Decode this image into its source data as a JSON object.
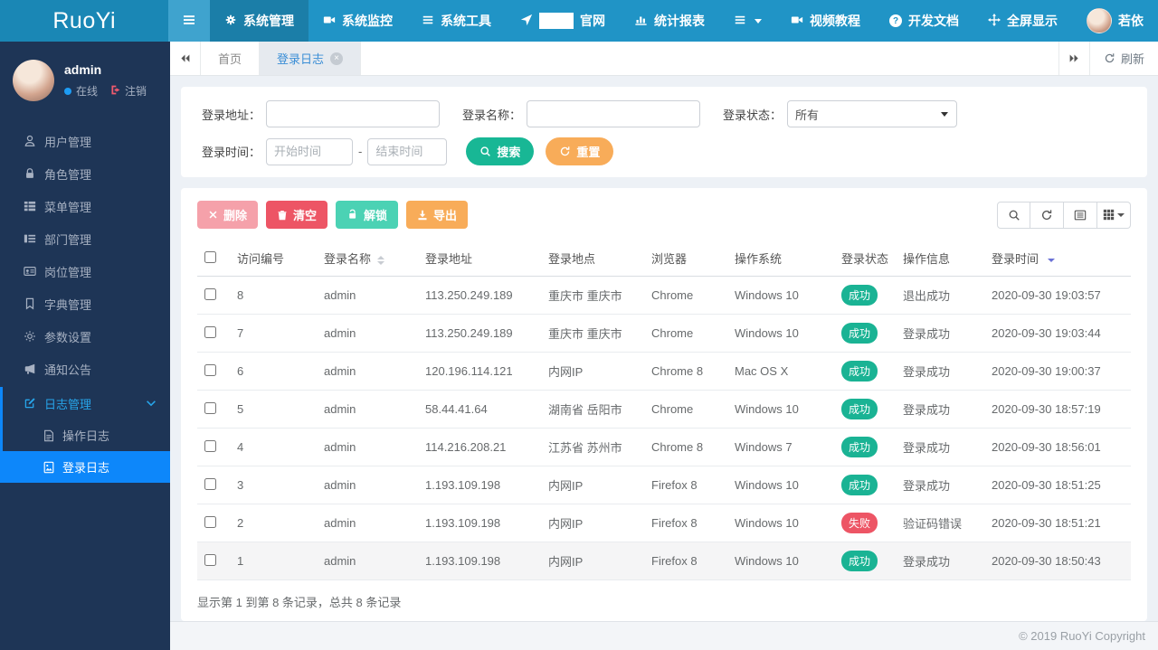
{
  "colors": {
    "navbar": "#2094c6",
    "sidebar": "#1e3556",
    "active_blue": "#0d87fa",
    "success": "#1ab394",
    "danger": "#ed5565",
    "warning": "#f8ac59"
  },
  "icons": {
    "hamburger": "bars",
    "tab_back": "«",
    "tab_forward": "»",
    "caret_down": "▾"
  },
  "navbar": {
    "brand": "RuoYi",
    "menu": [
      {
        "label": "系统管理",
        "icon": "gear-icon",
        "active": true
      },
      {
        "label": "系统监控",
        "icon": "video-camera-icon",
        "active": false
      },
      {
        "label": "系统工具",
        "icon": "bars-icon",
        "active": false
      },
      {
        "label": "官网",
        "icon": "location-arrow-icon",
        "active": false
      },
      {
        "label": "统计报表",
        "icon": "bar-chart-icon",
        "active": false
      }
    ],
    "right": [
      {
        "label": "视频教程",
        "icon": "video-camera-icon"
      },
      {
        "label": "开发文档",
        "icon": "question-circle-icon"
      },
      {
        "label": "全屏显示",
        "icon": "expand-icon"
      },
      {
        "label": "若依",
        "icon": "user-avatar"
      }
    ]
  },
  "sidebar": {
    "user": {
      "name": "admin",
      "online": "在线",
      "logout": "注销"
    },
    "items": [
      {
        "label": "用户管理",
        "icon": "user-icon"
      },
      {
        "label": "角色管理",
        "icon": "lock-icon"
      },
      {
        "label": "菜单管理",
        "icon": "menu-list-icon"
      },
      {
        "label": "部门管理",
        "icon": "department-icon"
      },
      {
        "label": "岗位管理",
        "icon": "id-card-icon"
      },
      {
        "label": "字典管理",
        "icon": "bookmark-icon"
      },
      {
        "label": "参数设置",
        "icon": "settings-icon"
      },
      {
        "label": "通知公告",
        "icon": "megaphone-icon"
      }
    ],
    "log_group": {
      "label": "日志管理",
      "children": [
        {
          "label": "操作日志",
          "active": false
        },
        {
          "label": "登录日志",
          "active": true
        }
      ]
    }
  },
  "tabbar": {
    "tabs": [
      {
        "label": "首页",
        "active": false
      },
      {
        "label": "登录日志",
        "active": true,
        "closable": true
      }
    ],
    "refresh_label": "刷新"
  },
  "search": {
    "address_label": "登录地址：",
    "name_label": "登录名称：",
    "status_label": "登录状态：",
    "status_value": "所有",
    "time_label": "登录时间：",
    "start_placeholder": "开始时间",
    "end_placeholder": "结束时间",
    "range_separator": "-",
    "search_button": "搜索",
    "reset_button": "重置"
  },
  "toolbar": {
    "delete_button": "删除",
    "clear_button": "清空",
    "unlock_button": "解锁",
    "export_button": "导出"
  },
  "table": {
    "headers": [
      "访问编号",
      "登录名称",
      "登录地址",
      "登录地点",
      "浏览器",
      "操作系统",
      "登录状态",
      "操作信息",
      "登录时间"
    ],
    "rows": [
      {
        "id": "8",
        "name": "admin",
        "ip": "113.250.249.189",
        "location": "重庆市 重庆市",
        "browser": "Chrome",
        "os": "Windows 10",
        "status": "成功",
        "status_type": "success",
        "message": "退出成功",
        "time": "2020-09-30 19:03:57"
      },
      {
        "id": "7",
        "name": "admin",
        "ip": "113.250.249.189",
        "location": "重庆市 重庆市",
        "browser": "Chrome",
        "os": "Windows 10",
        "status": "成功",
        "status_type": "success",
        "message": "登录成功",
        "time": "2020-09-30 19:03:44"
      },
      {
        "id": "6",
        "name": "admin",
        "ip": "120.196.114.121",
        "location": "内网IP",
        "browser": "Chrome 8",
        "os": "Mac OS X",
        "status": "成功",
        "status_type": "success",
        "message": "登录成功",
        "time": "2020-09-30 19:00:37"
      },
      {
        "id": "5",
        "name": "admin",
        "ip": "58.44.41.64",
        "location": "湖南省 岳阳市",
        "browser": "Chrome",
        "os": "Windows 10",
        "status": "成功",
        "status_type": "success",
        "message": "登录成功",
        "time": "2020-09-30 18:57:19"
      },
      {
        "id": "4",
        "name": "admin",
        "ip": "114.216.208.21",
        "location": "江苏省 苏州市",
        "browser": "Chrome 8",
        "os": "Windows 7",
        "status": "成功",
        "status_type": "success",
        "message": "登录成功",
        "time": "2020-09-30 18:56:01"
      },
      {
        "id": "3",
        "name": "admin",
        "ip": "1.193.109.198",
        "location": "内网IP",
        "browser": "Firefox 8",
        "os": "Windows 10",
        "status": "成功",
        "status_type": "success",
        "message": "登录成功",
        "time": "2020-09-30 18:51:25"
      },
      {
        "id": "2",
        "name": "admin",
        "ip": "1.193.109.198",
        "location": "内网IP",
        "browser": "Firefox 8",
        "os": "Windows 10",
        "status": "失败",
        "status_type": "fail",
        "message": "验证码错误",
        "time": "2020-09-30 18:51:21"
      },
      {
        "id": "1",
        "name": "admin",
        "ip": "1.193.109.198",
        "location": "内网IP",
        "browser": "Firefox 8",
        "os": "Windows 10",
        "status": "成功",
        "status_type": "success",
        "message": "登录成功",
        "time": "2020-09-30 18:50:43"
      }
    ]
  },
  "summary": "显示第 1 到第 8 条记录，总共 8 条记录",
  "footer": "© 2019 RuoYi Copyright"
}
